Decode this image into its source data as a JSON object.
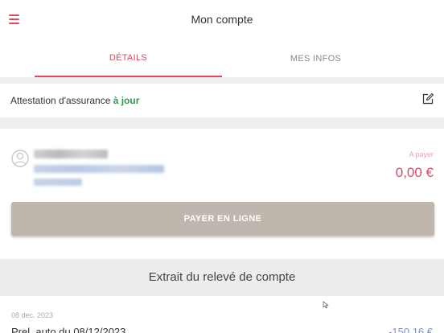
{
  "header": {
    "title": "Mon compte",
    "menu_icon": "hamburger-icon"
  },
  "tabs": [
    {
      "label": "DÉTAILS",
      "active": true
    },
    {
      "label": "MES INFOS",
      "active": false
    }
  ],
  "insurance": {
    "label": "Attestation d'assurance",
    "status": "à jour",
    "status_color": "#2e9b4a",
    "edit_icon": "edit-icon"
  },
  "account": {
    "to_pay_label": "A payer",
    "to_pay_amount": "0,00 €",
    "pay_button_label": "PAYER EN LIGNE"
  },
  "statement": {
    "title": "Extrait du relevé de compte",
    "entries": [
      {
        "date": "08 dec. 2023",
        "label": "Prel. auto du 08/12/2023",
        "amount": "-150,16 €"
      }
    ]
  },
  "colors": {
    "accent": "#e2465d",
    "button": "#bfb6ad"
  }
}
